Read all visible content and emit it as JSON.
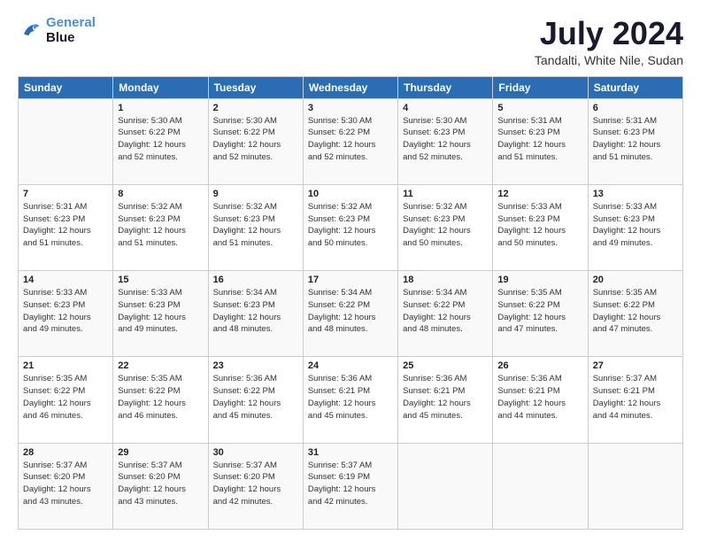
{
  "logo": {
    "line1": "General",
    "line2": "Blue"
  },
  "title": "July 2024",
  "subtitle": "Tandalti, White Nile, Sudan",
  "days_header": [
    "Sunday",
    "Monday",
    "Tuesday",
    "Wednesday",
    "Thursday",
    "Friday",
    "Saturday"
  ],
  "weeks": [
    [
      {
        "day": "",
        "info": ""
      },
      {
        "day": "1",
        "info": "Sunrise: 5:30 AM\nSunset: 6:22 PM\nDaylight: 12 hours\nand 52 minutes."
      },
      {
        "day": "2",
        "info": "Sunrise: 5:30 AM\nSunset: 6:22 PM\nDaylight: 12 hours\nand 52 minutes."
      },
      {
        "day": "3",
        "info": "Sunrise: 5:30 AM\nSunset: 6:22 PM\nDaylight: 12 hours\nand 52 minutes."
      },
      {
        "day": "4",
        "info": "Sunrise: 5:30 AM\nSunset: 6:23 PM\nDaylight: 12 hours\nand 52 minutes."
      },
      {
        "day": "5",
        "info": "Sunrise: 5:31 AM\nSunset: 6:23 PM\nDaylight: 12 hours\nand 51 minutes."
      },
      {
        "day": "6",
        "info": "Sunrise: 5:31 AM\nSunset: 6:23 PM\nDaylight: 12 hours\nand 51 minutes."
      }
    ],
    [
      {
        "day": "7",
        "info": "Sunrise: 5:31 AM\nSunset: 6:23 PM\nDaylight: 12 hours\nand 51 minutes."
      },
      {
        "day": "8",
        "info": "Sunrise: 5:32 AM\nSunset: 6:23 PM\nDaylight: 12 hours\nand 51 minutes."
      },
      {
        "day": "9",
        "info": "Sunrise: 5:32 AM\nSunset: 6:23 PM\nDaylight: 12 hours\nand 51 minutes."
      },
      {
        "day": "10",
        "info": "Sunrise: 5:32 AM\nSunset: 6:23 PM\nDaylight: 12 hours\nand 50 minutes."
      },
      {
        "day": "11",
        "info": "Sunrise: 5:32 AM\nSunset: 6:23 PM\nDaylight: 12 hours\nand 50 minutes."
      },
      {
        "day": "12",
        "info": "Sunrise: 5:33 AM\nSunset: 6:23 PM\nDaylight: 12 hours\nand 50 minutes."
      },
      {
        "day": "13",
        "info": "Sunrise: 5:33 AM\nSunset: 6:23 PM\nDaylight: 12 hours\nand 49 minutes."
      }
    ],
    [
      {
        "day": "14",
        "info": "Sunrise: 5:33 AM\nSunset: 6:23 PM\nDaylight: 12 hours\nand 49 minutes."
      },
      {
        "day": "15",
        "info": "Sunrise: 5:33 AM\nSunset: 6:23 PM\nDaylight: 12 hours\nand 49 minutes."
      },
      {
        "day": "16",
        "info": "Sunrise: 5:34 AM\nSunset: 6:23 PM\nDaylight: 12 hours\nand 48 minutes."
      },
      {
        "day": "17",
        "info": "Sunrise: 5:34 AM\nSunset: 6:22 PM\nDaylight: 12 hours\nand 48 minutes."
      },
      {
        "day": "18",
        "info": "Sunrise: 5:34 AM\nSunset: 6:22 PM\nDaylight: 12 hours\nand 48 minutes."
      },
      {
        "day": "19",
        "info": "Sunrise: 5:35 AM\nSunset: 6:22 PM\nDaylight: 12 hours\nand 47 minutes."
      },
      {
        "day": "20",
        "info": "Sunrise: 5:35 AM\nSunset: 6:22 PM\nDaylight: 12 hours\nand 47 minutes."
      }
    ],
    [
      {
        "day": "21",
        "info": "Sunrise: 5:35 AM\nSunset: 6:22 PM\nDaylight: 12 hours\nand 46 minutes."
      },
      {
        "day": "22",
        "info": "Sunrise: 5:35 AM\nSunset: 6:22 PM\nDaylight: 12 hours\nand 46 minutes."
      },
      {
        "day": "23",
        "info": "Sunrise: 5:36 AM\nSunset: 6:22 PM\nDaylight: 12 hours\nand 45 minutes."
      },
      {
        "day": "24",
        "info": "Sunrise: 5:36 AM\nSunset: 6:21 PM\nDaylight: 12 hours\nand 45 minutes."
      },
      {
        "day": "25",
        "info": "Sunrise: 5:36 AM\nSunset: 6:21 PM\nDaylight: 12 hours\nand 45 minutes."
      },
      {
        "day": "26",
        "info": "Sunrise: 5:36 AM\nSunset: 6:21 PM\nDaylight: 12 hours\nand 44 minutes."
      },
      {
        "day": "27",
        "info": "Sunrise: 5:37 AM\nSunset: 6:21 PM\nDaylight: 12 hours\nand 44 minutes."
      }
    ],
    [
      {
        "day": "28",
        "info": "Sunrise: 5:37 AM\nSunset: 6:20 PM\nDaylight: 12 hours\nand 43 minutes."
      },
      {
        "day": "29",
        "info": "Sunrise: 5:37 AM\nSunset: 6:20 PM\nDaylight: 12 hours\nand 43 minutes."
      },
      {
        "day": "30",
        "info": "Sunrise: 5:37 AM\nSunset: 6:20 PM\nDaylight: 12 hours\nand 42 minutes."
      },
      {
        "day": "31",
        "info": "Sunrise: 5:37 AM\nSunset: 6:19 PM\nDaylight: 12 hours\nand 42 minutes."
      },
      {
        "day": "",
        "info": ""
      },
      {
        "day": "",
        "info": ""
      },
      {
        "day": "",
        "info": ""
      }
    ]
  ]
}
